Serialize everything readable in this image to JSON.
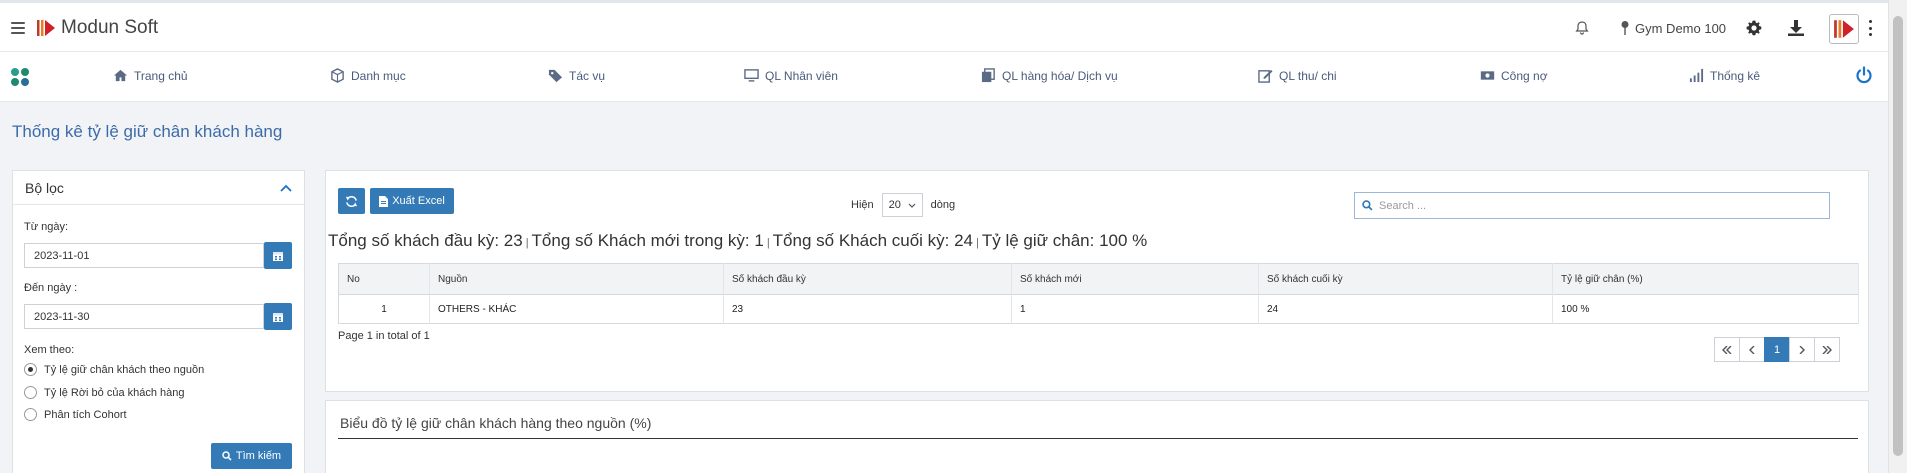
{
  "header": {
    "brand": "Modun Soft",
    "gym_name": "Gym Demo 100"
  },
  "nav": {
    "items": [
      {
        "label": "Trang chủ",
        "icon": "home-icon"
      },
      {
        "label": "Danh mục",
        "icon": "cube-icon"
      },
      {
        "label": "Tác vụ",
        "icon": "tag-icon"
      },
      {
        "label": "QL Nhân viên",
        "icon": "monitor-icon"
      },
      {
        "label": "QL hàng hóa/ Dịch vụ",
        "icon": "copy-icon"
      },
      {
        "label": "QL thu/ chi",
        "icon": "edit-icon"
      },
      {
        "label": "Công nợ",
        "icon": "money-icon"
      },
      {
        "label": "Thống kê",
        "icon": "signal-icon"
      }
    ]
  },
  "page": {
    "title": "Thống kê tỷ lệ giữ chân khách hàng"
  },
  "filter": {
    "title": "Bộ lọc",
    "from_label": "Từ ngày:",
    "from_value": "2023-11-01",
    "to_label": "Đến ngày :",
    "to_value": "2023-11-30",
    "view_label": "Xem theo:",
    "options": [
      {
        "label": "Tỷ lệ giữ chân khách theo nguồn",
        "selected": true
      },
      {
        "label": "Tỷ lệ Rời bỏ của khách hàng",
        "selected": false
      },
      {
        "label": "Phân tích Cohort",
        "selected": false
      }
    ],
    "search_label": "Tìm kiếm"
  },
  "toolbar": {
    "excel_label": "Xuất Excel",
    "show_label": "Hiện",
    "page_size": "20",
    "rows_label": "dòng",
    "search_placeholder": "Search ..."
  },
  "summary": {
    "start_total": "Tổng số khách đầu kỳ: 23",
    "new_total": "Tổng số Khách mới trong kỳ: 1",
    "end_total": "Tổng số Khách cuối kỳ: 24",
    "retention": "Tỷ lệ giữ chân: 100 %",
    "separator": "|"
  },
  "table": {
    "columns": [
      "No",
      "Nguồn",
      "Số khách đầu kỳ",
      "Số khách mới",
      "Số khách cuối kỳ",
      "Tỷ lệ giữ chân (%)"
    ],
    "rows": [
      [
        "1",
        "OTHERS - KHÁC",
        "23",
        "1",
        "24",
        "100 %"
      ]
    ]
  },
  "pagination": {
    "info": "Page 1 in total of 1",
    "current": "1"
  },
  "chart": {
    "title": "Biểu đồ tỷ lệ giữ chân khách hàng theo nguồn (%)"
  },
  "colors": {
    "primary": "#337ab7",
    "title_blue": "#3c6ca8"
  }
}
